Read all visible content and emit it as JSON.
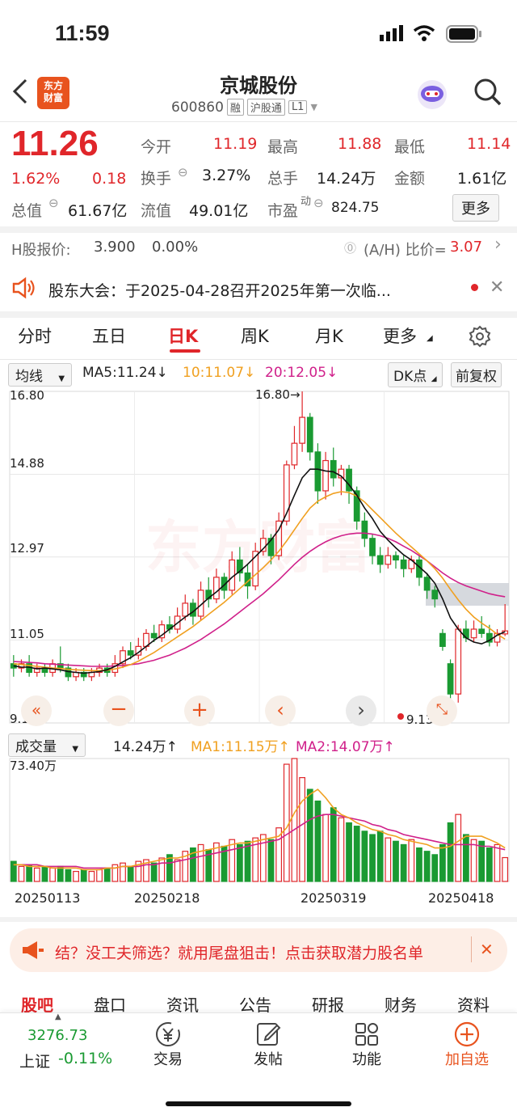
{
  "status": {
    "time": "11:59"
  },
  "header": {
    "logo_text_1": "东方",
    "logo_text_2": "财富",
    "stock_name": "京城股份",
    "stock_code": "600860",
    "tags": [
      "融",
      "沪股通",
      "L1"
    ]
  },
  "quote": {
    "price": "11.26",
    "change_pct": "1.62%",
    "change_amt": "0.18",
    "open_label": "今开",
    "open": "11.19",
    "high_label": "最高",
    "high": "11.88",
    "low_label": "最低",
    "low": "11.14",
    "turnover_label": "换手",
    "turnover": "3.27%",
    "volume_label": "总手",
    "volume": "14.24万",
    "amount_label": "金额",
    "amount": "1.61亿",
    "mktcap_label": "总值",
    "mktcap": "61.67亿",
    "float_label": "流值",
    "float": "49.01亿",
    "pe_label": "市盈",
    "pe_sup": "动",
    "pe": "824.75",
    "more_label": "更多"
  },
  "hshare": {
    "label": "H股报价:",
    "price": "3.900",
    "pct": "0.00%",
    "ratio_label": "(A/H) 比价=",
    "ratio": "3.07"
  },
  "notice": {
    "text": "股东大会：于2025-04-28召开2025年第一次临..."
  },
  "tabs": [
    "分时",
    "五日",
    "日K",
    "周K",
    "月K",
    "更多"
  ],
  "active_tab": "日K",
  "kline_header": {
    "indicator": "均线",
    "ma5": "MA5:11.24↓",
    "ma10": "10:11.07↓",
    "ma20": "20:12.05↓",
    "dk": "DK点",
    "adjust": "前复权"
  },
  "kline_axis": {
    "y_labels": [
      "16.80",
      "14.88",
      "12.97",
      "11.05",
      "9.13"
    ],
    "high_marker": "16.80→",
    "low_marker": "9.13→"
  },
  "volume_header": {
    "indicator": "成交量",
    "value": "14.24万↑",
    "ma1": "MA1:11.15万↑",
    "ma2": "MA2:14.07万↑",
    "max_label": "73.40万"
  },
  "dates": [
    "20250113",
    "20250218",
    "20250319",
    "20250418"
  ],
  "banner": {
    "text": "结？没工夫筛选？就用尾盘狙击！点击获取潜力股名单"
  },
  "bottom_tabs": [
    "股吧",
    "盘口",
    "资讯",
    "公告",
    "研报",
    "财务",
    "资料"
  ],
  "bottom_bar": {
    "index_value": "3276.73",
    "index_name": "上证",
    "index_change": "-0.11%",
    "trade": "交易",
    "post": "发帖",
    "function": "功能",
    "add": "加自选"
  },
  "colors": {
    "up": "#e0262a",
    "down": "#1a9a32",
    "ma5": "#111111",
    "ma10": "#f0a020",
    "ma20": "#d0208a"
  },
  "chart_data": {
    "type": "candlestick",
    "ylim": [
      9.13,
      16.8
    ],
    "candles": [
      [
        10.5,
        10.4,
        10.7,
        10.2
      ],
      [
        10.4,
        10.5,
        10.6,
        10.3
      ],
      [
        10.5,
        10.3,
        10.7,
        10.2
      ],
      [
        10.3,
        10.4,
        10.5,
        10.2
      ],
      [
        10.4,
        10.3,
        10.5,
        10.2
      ],
      [
        10.3,
        10.5,
        10.6,
        10.2
      ],
      [
        10.5,
        10.4,
        10.9,
        10.3
      ],
      [
        10.4,
        10.2,
        10.5,
        10.1
      ],
      [
        10.2,
        10.3,
        10.4,
        10.1
      ],
      [
        10.3,
        10.2,
        10.4,
        10.1
      ],
      [
        10.2,
        10.3,
        10.4,
        10.1
      ],
      [
        10.3,
        10.4,
        10.5,
        10.2
      ],
      [
        10.4,
        10.3,
        10.5,
        10.2
      ],
      [
        10.3,
        10.5,
        10.7,
        10.2
      ],
      [
        10.5,
        10.8,
        10.9,
        10.4
      ],
      [
        10.8,
        10.7,
        11.0,
        10.6
      ],
      [
        10.7,
        10.9,
        11.1,
        10.6
      ],
      [
        10.9,
        11.2,
        11.3,
        10.8
      ],
      [
        11.2,
        11.1,
        11.4,
        11.0
      ],
      [
        11.1,
        11.4,
        11.5,
        11.0
      ],
      [
        11.4,
        11.3,
        11.6,
        11.2
      ],
      [
        11.3,
        11.6,
        11.8,
        11.2
      ],
      [
        11.6,
        11.9,
        12.1,
        11.5
      ],
      [
        11.9,
        11.6,
        12.0,
        11.4
      ],
      [
        11.6,
        12.2,
        12.4,
        11.5
      ],
      [
        12.2,
        12.0,
        12.5,
        11.8
      ],
      [
        12.0,
        12.5,
        12.7,
        11.9
      ],
      [
        12.5,
        12.2,
        12.6,
        12.0
      ],
      [
        12.2,
        12.9,
        13.1,
        12.1
      ],
      [
        12.9,
        12.6,
        13.2,
        12.4
      ],
      [
        12.6,
        12.3,
        12.8,
        12.0
      ],
      [
        12.3,
        13.1,
        13.3,
        12.2
      ],
      [
        13.1,
        13.4,
        13.6,
        13.0
      ],
      [
        13.4,
        13.0,
        13.5,
        12.8
      ],
      [
        13.0,
        13.8,
        14.0,
        12.9
      ],
      [
        13.8,
        15.1,
        15.2,
        13.7
      ],
      [
        15.1,
        15.6,
        16.0,
        15.0
      ],
      [
        15.6,
        16.2,
        16.8,
        15.4
      ],
      [
        16.2,
        15.4,
        16.3,
        15.2
      ],
      [
        15.4,
        14.5,
        15.6,
        14.2
      ],
      [
        14.5,
        15.2,
        15.4,
        14.3
      ],
      [
        15.2,
        14.8,
        15.5,
        14.6
      ],
      [
        14.8,
        15.0,
        15.1,
        14.4
      ],
      [
        15.0,
        14.5,
        15.1,
        14.2
      ],
      [
        14.5,
        13.8,
        14.6,
        13.6
      ],
      [
        13.8,
        13.4,
        14.0,
        13.2
      ],
      [
        13.4,
        13.0,
        13.5,
        12.8
      ],
      [
        13.0,
        12.8,
        13.2,
        12.6
      ],
      [
        12.8,
        13.0,
        13.2,
        12.7
      ],
      [
        13.0,
        12.9,
        13.1,
        12.7
      ],
      [
        12.9,
        12.7,
        13.0,
        12.5
      ],
      [
        12.7,
        12.9,
        13.0,
        12.6
      ],
      [
        12.9,
        12.5,
        13.0,
        12.3
      ],
      [
        12.5,
        12.2,
        12.6,
        12.0
      ],
      [
        12.2,
        12.0,
        12.3,
        11.8
      ],
      [
        11.2,
        10.9,
        11.3,
        10.8
      ],
      [
        10.5,
        9.8,
        10.6,
        9.13
      ],
      [
        9.8,
        11.3,
        11.4,
        9.6
      ],
      [
        11.3,
        11.1,
        11.5,
        11.0
      ],
      [
        11.1,
        11.3,
        11.5,
        11.0
      ],
      [
        11.3,
        11.2,
        11.6,
        11.1
      ],
      [
        11.2,
        11.0,
        11.4,
        10.9
      ],
      [
        11.0,
        11.2,
        11.3,
        10.9
      ],
      [
        11.19,
        11.26,
        11.88,
        11.14
      ]
    ],
    "volumes": [
      12,
      9,
      10,
      8,
      9,
      8,
      9,
      7,
      6,
      7,
      6,
      7,
      8,
      10,
      11,
      9,
      12,
      13,
      11,
      14,
      16,
      13,
      18,
      20,
      22,
      19,
      23,
      21,
      25,
      22,
      24,
      26,
      28,
      25,
      32,
      70,
      73.4,
      62,
      55,
      48,
      40,
      44,
      38,
      35,
      33,
      30,
      28,
      30,
      26,
      24,
      22,
      25,
      20,
      18,
      16,
      22,
      35,
      40,
      28,
      25,
      24,
      20,
      22,
      14.24
    ],
    "ma5": [
      10.45,
      10.42,
      10.42,
      10.38,
      10.4,
      10.38,
      10.36,
      10.32,
      10.3,
      10.28,
      10.3,
      10.32,
      10.36,
      10.44,
      10.54,
      10.64,
      10.76,
      10.9,
      11.04,
      11.16,
      11.3,
      11.44,
      11.58,
      11.7,
      11.86,
      12.02,
      12.16,
      12.32,
      12.5,
      12.64,
      12.8,
      12.98,
      13.16,
      13.36,
      13.6,
      13.98,
      14.4,
      14.8,
      15.0,
      15.0,
      14.96,
      14.94,
      14.84,
      14.64,
      14.4,
      14.1,
      13.86,
      13.56,
      13.36,
      13.18,
      13.02,
      12.9,
      12.74,
      12.58,
      12.36,
      12.0,
      11.56,
      11.3,
      11.1,
      11.0,
      10.96,
      11.04,
      11.16,
      11.24
    ],
    "ma10": [
      10.5,
      10.48,
      10.46,
      10.44,
      10.42,
      10.4,
      10.39,
      10.37,
      10.36,
      10.35,
      10.34,
      10.34,
      10.35,
      10.38,
      10.42,
      10.48,
      10.56,
      10.66,
      10.76,
      10.88,
      11.0,
      11.12,
      11.24,
      11.36,
      11.5,
      11.64,
      11.78,
      11.92,
      12.08,
      12.24,
      12.4,
      12.56,
      12.72,
      12.9,
      13.1,
      13.34,
      13.6,
      13.86,
      14.1,
      14.26,
      14.36,
      14.44,
      14.48,
      14.46,
      14.38,
      14.24,
      14.06,
      13.88,
      13.7,
      13.52,
      13.36,
      13.2,
      13.04,
      12.88,
      12.7,
      12.48,
      12.22,
      11.98,
      11.76,
      11.58,
      11.44,
      11.32,
      11.18,
      11.07
    ],
    "ma20": [
      10.55,
      10.54,
      10.53,
      10.52,
      10.5,
      10.49,
      10.48,
      10.47,
      10.46,
      10.45,
      10.44,
      10.44,
      10.44,
      10.45,
      10.46,
      10.48,
      10.5,
      10.54,
      10.58,
      10.64,
      10.7,
      10.78,
      10.86,
      10.96,
      11.06,
      11.18,
      11.3,
      11.42,
      11.56,
      11.7,
      11.84,
      11.98,
      12.12,
      12.28,
      12.44,
      12.62,
      12.8,
      12.96,
      13.1,
      13.22,
      13.32,
      13.4,
      13.46,
      13.5,
      13.52,
      13.52,
      13.5,
      13.46,
      13.4,
      13.32,
      13.22,
      13.12,
      13.0,
      12.88,
      12.74,
      12.6,
      12.48,
      12.38,
      12.3,
      12.24,
      12.18,
      12.12,
      12.08,
      12.05
    ],
    "vol_ma1": [
      10,
      10,
      9,
      9,
      9,
      8,
      8,
      8,
      8,
      7,
      7,
      7,
      8,
      8,
      9,
      9,
      10,
      11,
      12,
      13,
      14,
      14,
      15,
      17,
      18,
      19,
      20,
      21,
      22,
      23,
      23,
      24,
      25,
      26,
      27,
      32,
      41,
      48,
      52,
      55,
      50,
      44,
      40,
      38,
      35,
      33,
      31,
      30,
      28,
      27,
      25,
      24,
      23,
      22,
      20,
      20,
      21,
      24,
      27,
      27,
      27,
      25,
      23,
      20
    ],
    "vol_ma2": [
      10,
      10,
      10,
      10,
      9,
      9,
      9,
      9,
      9,
      8,
      8,
      8,
      8,
      8,
      9,
      9,
      9,
      10,
      10,
      11,
      11,
      12,
      13,
      14,
      15,
      16,
      17,
      18,
      19,
      20,
      21,
      22,
      23,
      24,
      25,
      28,
      31,
      34,
      37,
      39,
      40,
      40,
      39,
      38,
      37,
      36,
      34,
      33,
      31,
      30,
      28,
      27,
      26,
      25,
      24,
      23,
      22,
      22,
      22,
      22,
      21,
      21,
      20,
      19
    ]
  }
}
